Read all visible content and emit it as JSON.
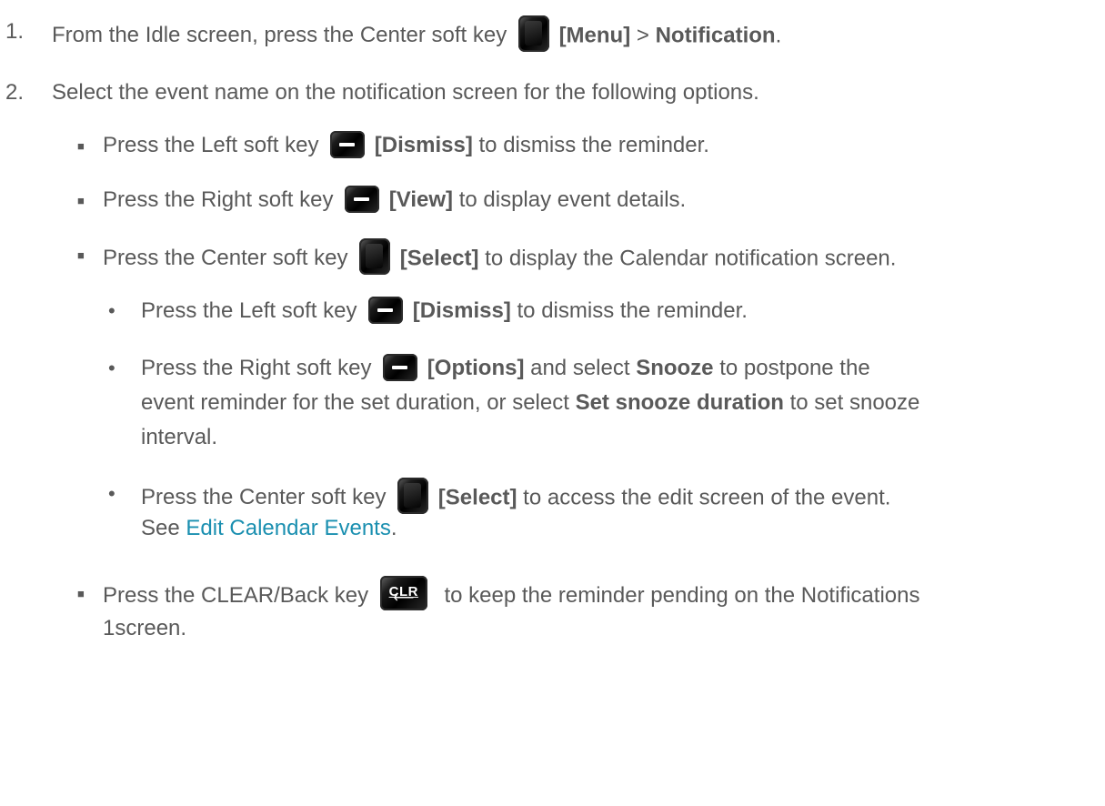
{
  "steps": [
    {
      "number": "1.",
      "pre": "From the Idle screen, press the Center soft key",
      "key_label": "[Menu]",
      "mid": " > ",
      "bold": "Notification",
      "post": "."
    },
    {
      "number": "2.",
      "text": "Select the event name on the notification screen for the following options."
    }
  ],
  "bullets": [
    {
      "pre": "Press the Left soft key",
      "key_label": "[Dismiss]",
      "post": " to dismiss the reminder."
    },
    {
      "pre": "Press the Right soft key",
      "key_label": "[View]",
      "post": " to display event details."
    },
    {
      "pre": "Press the Center soft key",
      "key_label": "[Select]",
      "post": " to display the Calendar notification screen."
    }
  ],
  "sub_bullets": [
    {
      "pre": "Press the Left soft key",
      "key_label": "[Dismiss]",
      "post": " to dismiss the reminder."
    },
    {
      "pre": "Press the Right soft key",
      "key_label": "[Options]",
      "mid": " and select ",
      "bold1": "Snooze",
      "post1": " to postpone the",
      "line2_pre": "event reminder for the set duration, or select ",
      "bold2": "Set snooze duration",
      "line2_post": " to set snooze",
      "line3": "interval."
    },
    {
      "pre": "Press the Center soft key",
      "key_label": "[Select]",
      "post": " to access the edit screen of the event.",
      "line2_pre": "See ",
      "link": "Edit Calendar Events",
      "line2_post": "."
    }
  ],
  "last_bullet": {
    "pre": "Press the CLEAR/Back key",
    "key_text": "CLR",
    "key_arrow": "⟵",
    "post": "to keep the reminder pending on the Notifications",
    "line2": "1screen."
  },
  "icons": {
    "bullet": "square-bullet",
    "sub_bullet": "round-bullet",
    "center_key": "center-soft-key-icon",
    "soft_key": "soft-key-icon",
    "clr_key": "clr-back-key-icon"
  }
}
